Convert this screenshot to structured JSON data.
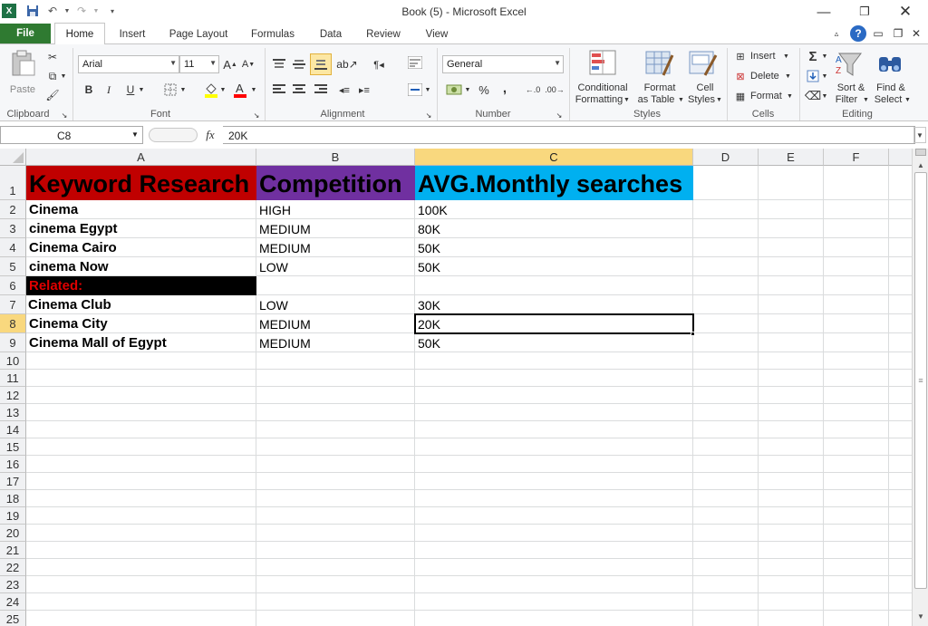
{
  "window": {
    "title": "Book (5)  -  Microsoft Excel"
  },
  "ribbon_tabs": [
    "File",
    "Home",
    "Insert",
    "Page Layout",
    "Formulas",
    "Data",
    "Review",
    "View"
  ],
  "ribbon": {
    "clipboard": {
      "label": "Clipboard",
      "paste": "Paste"
    },
    "font": {
      "label": "Font",
      "name": "Arial",
      "size": "11",
      "bold": "B",
      "italic": "I",
      "underline": "U"
    },
    "alignment": {
      "label": "Alignment"
    },
    "number": {
      "label": "Number",
      "format": "General",
      "percent": "%",
      "comma": ","
    },
    "styles": {
      "label": "Styles",
      "cond1": "Conditional",
      "cond2": "Formatting",
      "fmt1": "Format",
      "fmt2": "as Table",
      "cell1": "Cell",
      "cell2": "Styles"
    },
    "cells": {
      "label": "Cells",
      "insert": "Insert",
      "delete": "Delete",
      "format": "Format"
    },
    "editing": {
      "label": "Editing",
      "sort1": "Sort &",
      "sort2": "Filter",
      "find1": "Find &",
      "find2": "Select"
    }
  },
  "formula_bar": {
    "name_box": "C8",
    "fx": "fx",
    "value": "20K"
  },
  "columns": [
    "A",
    "B",
    "C",
    "D",
    "E",
    "F"
  ],
  "rows": [
    "1",
    "2",
    "3",
    "4",
    "5",
    "6",
    "7",
    "8",
    "9",
    "10",
    "11",
    "12",
    "13",
    "14",
    "15",
    "16",
    "17",
    "18",
    "19",
    "20",
    "21",
    "22",
    "23",
    "24",
    "25"
  ],
  "cells": {
    "A1": "Keyword Research",
    "B1": "Competition",
    "C1": "AVG.Monthly searches",
    "A2": "Cinema",
    "B2": "HIGH",
    "C2": "100K",
    "A3": "cinema Egypt",
    "B3": "MEDIUM",
    "C3": "80K",
    "A4": "Cinema Cairo",
    "B4": "MEDIUM",
    "C4": "50K",
    "A5": "cinema Now",
    "B5": "LOW",
    "C5": "50K",
    "A6": "Related:",
    "A7": "Cinema Club",
    "B7": "LOW",
    "C7": "30K",
    "A8": "Cinema City",
    "B8": "MEDIUM",
    "C8": "20K",
    "A9": "Cinema Mall of Egypt",
    "B9": "MEDIUM",
    "C9": "50K"
  },
  "colors": {
    "a1_fill": "#c00000",
    "b1_fill": "#7030a0",
    "c1_fill": "#00b0f0",
    "a6_fill": "#000000",
    "a6_text": "#e00000",
    "file_tab": "#2f7a31"
  }
}
